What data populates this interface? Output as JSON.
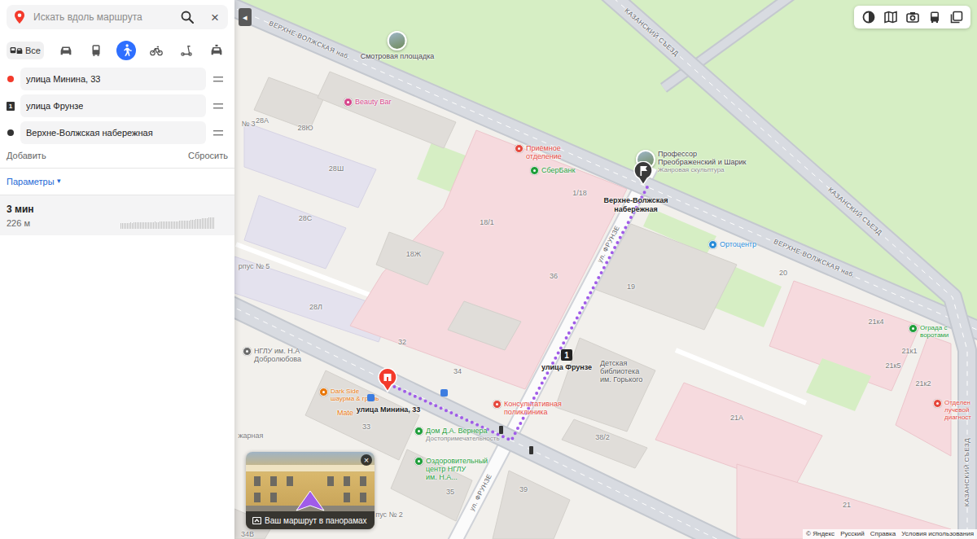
{
  "sidebar": {
    "search": {
      "placeholder": "Искать вдоль маршрута",
      "close": "×"
    },
    "modes": [
      {
        "kind": "all",
        "label": "Все",
        "selected": false
      },
      {
        "kind": "car",
        "selected": false
      },
      {
        "kind": "bus",
        "selected": false
      },
      {
        "kind": "walk",
        "selected": true
      },
      {
        "kind": "bike",
        "selected": false
      },
      {
        "kind": "scooter",
        "selected": false
      },
      {
        "kind": "taxi",
        "selected": false
      }
    ],
    "waypoints": [
      {
        "kind": "start",
        "label": "улица Минина, 33",
        "color": "#f33a2b"
      },
      {
        "kind": "via",
        "badge": "1",
        "label": "улица Фрунзе"
      },
      {
        "kind": "finish",
        "label": "Верхне-Волжская набережная",
        "color": "#333333"
      }
    ],
    "add": "Добавить",
    "reset": "Сбросить",
    "parameters": {
      "label": "Параметры",
      "caret": "▾"
    },
    "route": {
      "time": "3 мин",
      "distance": "226 м",
      "elevation": [
        141.6,
        141.6,
        141.7,
        141.7,
        141.6,
        141.7,
        141.8,
        141.7,
        141.8,
        141.8,
        141.9,
        141.8,
        141.8,
        141.9,
        141.9,
        142.0,
        141.9,
        141.9,
        142.0,
        142.0,
        142.0,
        142.1,
        142.0,
        142.0,
        142.1,
        142.1,
        142.2,
        142.1,
        142.1,
        142.2,
        142.2,
        142.2,
        142.3,
        142.3,
        142.2,
        142.3,
        142.4,
        142.4,
        142.4,
        142.5,
        142.5,
        142.6,
        142.6,
        142.7,
        142.7,
        142.8,
        142.9,
        143.0,
        143.0,
        143.1,
        143.2,
        143.3,
        143.3,
        143.4,
        143.5,
        143.5,
        143.6,
        143.6
      ]
    }
  },
  "map": {
    "collapse": "◂",
    "streets": [
      "КАЗАНСКИЙ СЪЕЗД",
      "КАЗАНСКИЙ СЪЕЗД",
      "КАЗАНСКИЙ СЪЕЗД",
      "ВЕРХНЕ-ВОЛЖСКАЯ наб.",
      "ВЕРХНЕ-ВОЛЖСКАЯ наб.",
      "ул. ФРУНЗЕ",
      "ул. ФРУНЗЕ"
    ],
    "houses": [
      "28А",
      "28Ю",
      "№ 3",
      "28Ш",
      "28С",
      "18Ж",
      "18/1",
      "1/18",
      "36",
      "32",
      "34",
      "28Л",
      "19",
      "20",
      "21к4",
      "21к5",
      "21к1",
      "21к2",
      "21А",
      "21",
      "38/2",
      "39",
      "35",
      "33",
      "34В",
      "рпус № 5",
      "пус № 2",
      "жарная"
    ],
    "pois": [
      {
        "kind": "photo",
        "lines": [
          "Смотровая площадка"
        ],
        "color": "#444444"
      },
      {
        "kind": "icon",
        "lines": [
          "Beauty Bar"
        ],
        "color": "#d6478c"
      },
      {
        "kind": "icon",
        "lines": [
          "Приёмное",
          "отделение"
        ],
        "color": "#e5483d"
      },
      {
        "kind": "icon",
        "lines": [
          "СберБанк"
        ],
        "color": "#1f9e3a"
      },
      {
        "kind": "photo",
        "lines": [
          "Профессор",
          "Преображенский и Шарик"
        ],
        "subtitle": "Жанровая скульптура",
        "color": "#444444"
      },
      {
        "kind": "icon",
        "lines": [
          "Ортоцентр"
        ],
        "color": "#2a8bd8"
      },
      {
        "kind": "icon",
        "lines": [
          "Ограда с",
          "воротами"
        ],
        "color": "#1f9e3a"
      },
      {
        "kind": "icon",
        "lines": [
          "Отделен",
          "лучевой",
          "диагност"
        ],
        "color": "#e5483d"
      },
      {
        "kind": "icon",
        "lines": [
          "НГЛУ им. Н.А",
          "Добролюбова"
        ],
        "color": "#6b6b6b"
      },
      {
        "kind": "icon",
        "lines": [
          "Dark Side",
          "шаурма & гриль"
        ],
        "color": "#e8780c"
      },
      {
        "kind": "plain",
        "lines": [
          "Mate"
        ],
        "color": "#e8780c"
      },
      {
        "kind": "icon",
        "lines": [
          "Консультативная",
          "поликлиника"
        ],
        "color": "#e5483d"
      },
      {
        "kind": "icon",
        "lines": [
          "Дом Д.А. Вернера"
        ],
        "subtitle": "Достопримечательность",
        "color": "#1f9e3a"
      },
      {
        "kind": "icon",
        "lines": [
          "Оздоровительный",
          "центр НГЛУ",
          "им. Н.А..."
        ],
        "color": "#1f9e3a"
      },
      {
        "kind": "plain",
        "lines": [
          "Детская",
          "библиотека",
          "им. Горького"
        ],
        "color": "#555555"
      }
    ],
    "route": [
      {
        "kind": "start",
        "label": "улица Минина, 33"
      },
      {
        "kind": "via",
        "badge": "1",
        "label": "улица Фрунзе"
      },
      {
        "kind": "finish",
        "label": "Верхне-Волжская набережная"
      }
    ],
    "panorama": {
      "label": "Ваш маршрут в панорамах",
      "close": "×"
    },
    "attribution": [
      "© Яндекс",
      "Русский",
      "Справка",
      "Условия использования"
    ]
  }
}
